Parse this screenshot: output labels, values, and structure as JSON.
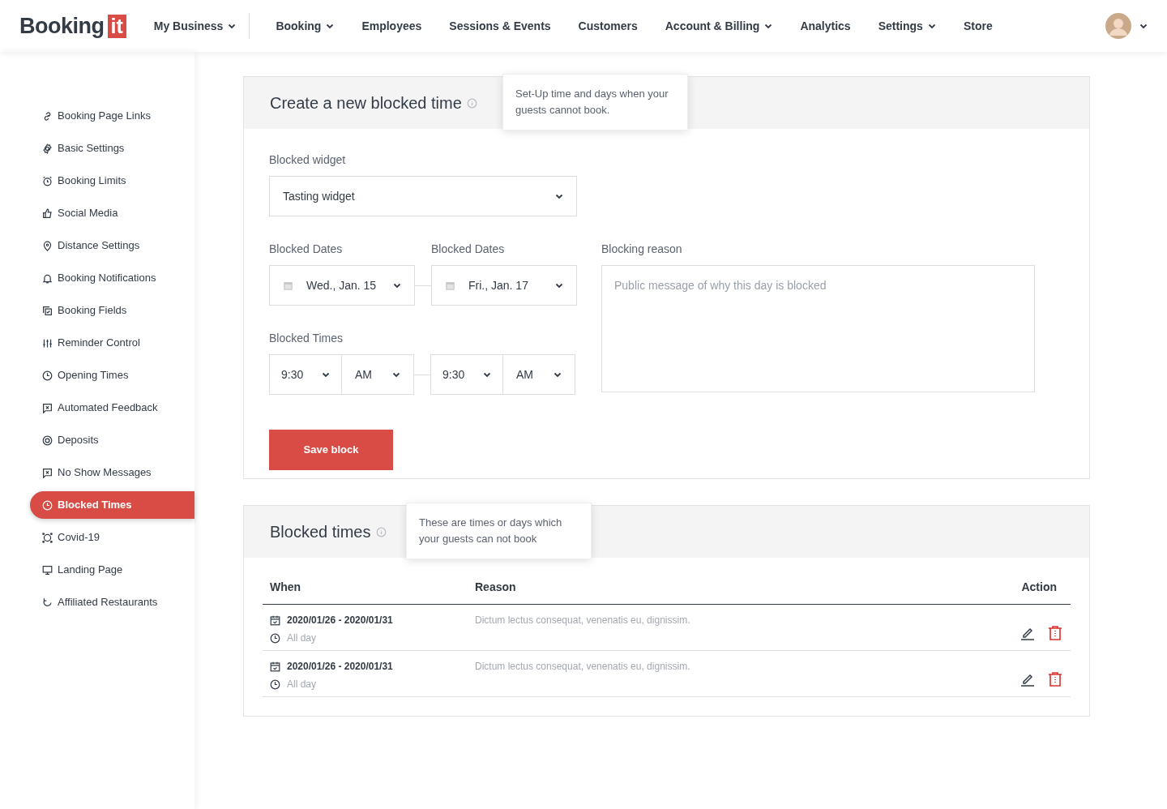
{
  "navbar": {
    "logo": {
      "text": "Booking",
      "badge": "it"
    },
    "business_menu": {
      "label": "My Business",
      "dropdown": true
    },
    "items": [
      {
        "label": "Booking",
        "dropdown": true
      },
      {
        "label": "Employees",
        "dropdown": false
      },
      {
        "label": "Sessions & Events",
        "dropdown": false
      },
      {
        "label": "Customers",
        "dropdown": false
      },
      {
        "label": "Account & Billing",
        "dropdown": true
      },
      {
        "label": "Analytics",
        "dropdown": false
      },
      {
        "label": "Settings",
        "dropdown": true
      },
      {
        "label": "Store",
        "dropdown": false
      }
    ],
    "user_menu": {
      "dropdown": true
    }
  },
  "sidebar": {
    "items": [
      {
        "label": "Booking Page Links",
        "selected": false
      },
      {
        "label": "Basic Settings",
        "selected": false
      },
      {
        "label": "Booking Limits",
        "selected": false
      },
      {
        "label": "Social Media",
        "selected": false
      },
      {
        "label": "Distance Settings",
        "selected": false
      },
      {
        "label": "Booking Notifications",
        "selected": false
      },
      {
        "label": "Booking Fields",
        "selected": false
      },
      {
        "label": "Reminder Control",
        "selected": false
      },
      {
        "label": "Opening Times",
        "selected": false
      },
      {
        "label": "Automated Feedback",
        "selected": false
      },
      {
        "label": "Deposits",
        "selected": false
      },
      {
        "label": "No Show Messages",
        "selected": false
      },
      {
        "label": "Blocked Times",
        "selected": true
      },
      {
        "label": "Covid-19",
        "selected": false
      },
      {
        "label": "Landing Page",
        "selected": false
      },
      {
        "label": "Affiliated Restaurants",
        "selected": false
      }
    ]
  },
  "create_panel": {
    "title": "Create a new blocked time",
    "tooltip": "Set-Up time and days when your guests cannot book.",
    "widget": {
      "label": "Blocked widget",
      "value": "Tasting widget"
    },
    "dates": {
      "start_label": "Blocked Dates",
      "end_label": "Blocked Dates",
      "start": "Wed., Jan. 15",
      "end": "Fri., Jan. 17"
    },
    "times": {
      "label": "Blocked Times",
      "start": {
        "time": "9:30",
        "period": "AM"
      },
      "end": {
        "time": "9:30",
        "period": "AM"
      }
    },
    "reason": {
      "label": "Blocking reason",
      "placeholder": "Public message of why this day is blocked"
    },
    "save_button": "Save block"
  },
  "list_panel": {
    "title": "Blocked times",
    "tooltip": "These are times or days which your guests can not book",
    "table": {
      "columns": [
        "When",
        "Reason",
        "Action"
      ],
      "rows": [
        {
          "dates": "2020/01/26 - 2020/01/31",
          "time": "All day",
          "reason": "Dictum lectus consequat, venenatis eu, dignissim."
        },
        {
          "dates": "2020/01/26 - 2020/01/31",
          "time": "All day",
          "reason": "Dictum lectus consequat, venenatis eu, dignissim."
        }
      ]
    }
  }
}
